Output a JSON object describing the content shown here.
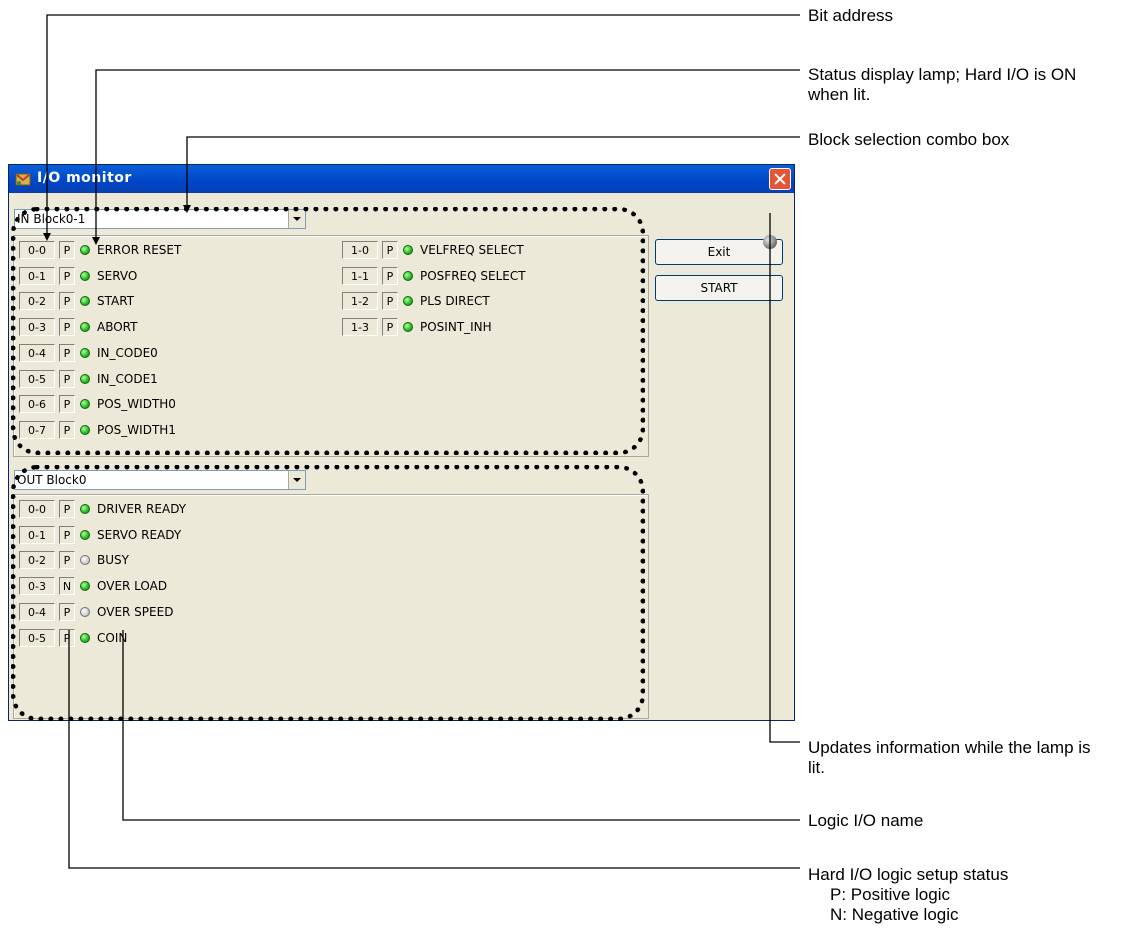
{
  "callouts": {
    "bit_address": "Bit address",
    "status_lamp": "Status display lamp; Hard I/O is ON when lit.",
    "block_combo": "Block selection combo box",
    "update_lamp": "Updates information while the lamp is lit.",
    "logic_name": "Logic I/O name",
    "logic_setup": {
      "title": "Hard I/O logic setup status",
      "positive": "P: Positive logic",
      "negative": "N: Negative logic"
    }
  },
  "window": {
    "title": "I/O monitor",
    "in_block": {
      "selected": "IN Block0-1",
      "left": [
        {
          "addr": "0-0",
          "logic": "P",
          "lamp": "on",
          "name": "ERROR RESET"
        },
        {
          "addr": "0-1",
          "logic": "P",
          "lamp": "on",
          "name": "SERVO"
        },
        {
          "addr": "0-2",
          "logic": "P",
          "lamp": "on",
          "name": "START"
        },
        {
          "addr": "0-3",
          "logic": "P",
          "lamp": "on",
          "name": "ABORT"
        },
        {
          "addr": "0-4",
          "logic": "P",
          "lamp": "on",
          "name": "IN_CODE0"
        },
        {
          "addr": "0-5",
          "logic": "P",
          "lamp": "on",
          "name": "IN_CODE1"
        },
        {
          "addr": "0-6",
          "logic": "P",
          "lamp": "on",
          "name": "POS_WIDTH0"
        },
        {
          "addr": "0-7",
          "logic": "P",
          "lamp": "on",
          "name": "POS_WIDTH1"
        }
      ],
      "right": [
        {
          "addr": "1-0",
          "logic": "P",
          "lamp": "on",
          "name": "VELFREQ SELECT"
        },
        {
          "addr": "1-1",
          "logic": "P",
          "lamp": "on",
          "name": "POSFREQ SELECT"
        },
        {
          "addr": "1-2",
          "logic": "P",
          "lamp": "on",
          "name": "PLS DIRECT"
        },
        {
          "addr": "1-3",
          "logic": "P",
          "lamp": "on",
          "name": "POSINT_INH"
        }
      ]
    },
    "out_block": {
      "selected": "OUT Block0",
      "rows": [
        {
          "addr": "0-0",
          "logic": "P",
          "lamp": "on",
          "name": "DRIVER READY"
        },
        {
          "addr": "0-1",
          "logic": "P",
          "lamp": "on",
          "name": "SERVO READY"
        },
        {
          "addr": "0-2",
          "logic": "P",
          "lamp": "off",
          "name": "BUSY"
        },
        {
          "addr": "0-3",
          "logic": "N",
          "lamp": "on",
          "name": "OVER LOAD"
        },
        {
          "addr": "0-4",
          "logic": "P",
          "lamp": "off",
          "name": "OVER SPEED"
        },
        {
          "addr": "0-5",
          "logic": "P",
          "lamp": "on",
          "name": "COIN"
        }
      ]
    },
    "buttons": {
      "exit": "Exit",
      "start": "START"
    }
  }
}
